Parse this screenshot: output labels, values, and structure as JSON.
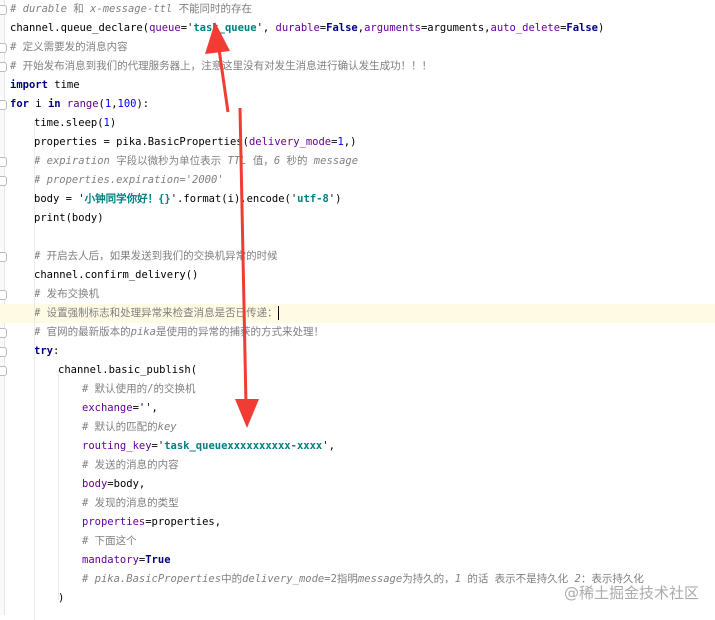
{
  "editor": {
    "lines": [
      {
        "i": 0,
        "fold": true,
        "tokens": [
          [
            "# durable ",
            "cm"
          ],
          [
            "和 ",
            "cn"
          ],
          [
            "x-message-ttl ",
            "cm"
          ],
          [
            "不能同时的存在",
            "cn"
          ]
        ]
      },
      {
        "i": 0,
        "tokens": [
          [
            "channel.queue_declare(",
            ""
          ],
          [
            "queue",
            "arg"
          ],
          [
            "='",
            ""
          ],
          [
            "task_queue",
            "str"
          ],
          [
            "', ",
            ""
          ],
          [
            "durable",
            "arg"
          ],
          [
            "=",
            ""
          ],
          [
            "False",
            "kw"
          ],
          [
            ",",
            ""
          ],
          [
            "arguments",
            "arg"
          ],
          [
            "=arguments,",
            ""
          ],
          [
            "auto_delete",
            "arg"
          ],
          [
            "=",
            ""
          ],
          [
            "False",
            "kw"
          ],
          [
            ")",
            ""
          ]
        ]
      },
      {
        "i": 0,
        "fold": true,
        "tokens": [
          [
            "# 定义需要发的消息内容",
            "cn"
          ]
        ]
      },
      {
        "i": 0,
        "fold": true,
        "tokens": [
          [
            "# 开始发布消息到我们的代理服务器上，注意这里没有对发生消息进行确认发生成功！！！",
            "cn"
          ]
        ]
      },
      {
        "i": 0,
        "tokens": [
          [
            "import",
            "kw"
          ],
          [
            " time",
            ""
          ]
        ]
      },
      {
        "i": 0,
        "fold": true,
        "tokens": [
          [
            "for",
            "kw"
          ],
          [
            " i ",
            ""
          ],
          [
            "in",
            "kw"
          ],
          [
            " ",
            ""
          ],
          [
            "range",
            "arg"
          ],
          [
            "(",
            ""
          ],
          [
            "1",
            "num"
          ],
          [
            ",",
            ""
          ],
          [
            "100",
            "num"
          ],
          [
            "):",
            ""
          ]
        ]
      },
      {
        "i": 1,
        "tokens": [
          [
            "time.sleep(",
            ""
          ],
          [
            "1",
            "num"
          ],
          [
            ")",
            ""
          ]
        ]
      },
      {
        "i": 1,
        "tokens": [
          [
            "properties = pika.BasicProperties(",
            ""
          ],
          [
            "delivery_mode",
            "arg"
          ],
          [
            "=",
            ""
          ],
          [
            "1",
            "num"
          ],
          [
            ",)",
            ""
          ]
        ]
      },
      {
        "i": 1,
        "fold": true,
        "tokens": [
          [
            "# expiration ",
            "cm"
          ],
          [
            "字段以微秒为单位表示 ",
            "cn"
          ],
          [
            "TTL ",
            "cm"
          ],
          [
            "值，",
            "cn"
          ],
          [
            "6 ",
            "cm"
          ],
          [
            "秒的 ",
            "cn"
          ],
          [
            "message",
            "cm"
          ]
        ]
      },
      {
        "i": 1,
        "fold": true,
        "tokens": [
          [
            "# properties.expiration='2000'",
            "cm"
          ]
        ]
      },
      {
        "i": 1,
        "tokens": [
          [
            "body = '",
            ""
          ],
          [
            "小钟同学你好！{}",
            "str"
          ],
          [
            "'.format(i).encode('",
            ""
          ],
          [
            "utf-8",
            "str"
          ],
          [
            "')",
            ""
          ]
        ]
      },
      {
        "i": 1,
        "tokens": [
          [
            "print(body)",
            ""
          ]
        ]
      },
      {
        "i": 1,
        "tokens": []
      },
      {
        "i": 1,
        "fold": true,
        "tokens": [
          [
            "# 开启去人后，如果发送到我们的交换机异常的时候",
            "cn"
          ]
        ]
      },
      {
        "i": 1,
        "tokens": [
          [
            "channel.confirm_delivery()",
            ""
          ]
        ]
      },
      {
        "i": 1,
        "fold": true,
        "tokens": [
          [
            "# 发布交换机",
            "cn"
          ]
        ]
      },
      {
        "i": 1,
        "hl": true,
        "caret": true,
        "tokens": [
          [
            "# 设置强制标志和处理异常来检查消息是否已传递：",
            "cn"
          ]
        ]
      },
      {
        "i": 1,
        "fold": true,
        "tokens": [
          [
            "# 官网的最新版本的",
            "cn"
          ],
          [
            "pika",
            "cm"
          ],
          [
            "是使用的异常的捕获的方式来处理！",
            "cn"
          ]
        ]
      },
      {
        "i": 1,
        "fold": true,
        "tokens": [
          [
            "try",
            "kw"
          ],
          [
            ":",
            ""
          ]
        ]
      },
      {
        "i": 2,
        "fold": true,
        "tokens": [
          [
            "channel.basic_publish(",
            ""
          ]
        ]
      },
      {
        "i": 3,
        "tokens": [
          [
            "# 默认使用的/的交换机",
            "cn"
          ]
        ]
      },
      {
        "i": 3,
        "tokens": [
          [
            "exchange",
            "arg"
          ],
          [
            "='',",
            ""
          ]
        ]
      },
      {
        "i": 3,
        "tokens": [
          [
            "# 默认的匹配的",
            "cn"
          ],
          [
            "key",
            "cm"
          ]
        ]
      },
      {
        "i": 3,
        "tokens": [
          [
            "routing_key",
            "arg"
          ],
          [
            "='",
            ""
          ],
          [
            "task_queuexxxxxxxxxx-xxxx",
            "str"
          ],
          [
            "',",
            ""
          ]
        ]
      },
      {
        "i": 3,
        "tokens": [
          [
            "# 发送的消息的内容",
            "cn"
          ]
        ]
      },
      {
        "i": 3,
        "tokens": [
          [
            "body",
            "arg"
          ],
          [
            "=body,",
            ""
          ]
        ]
      },
      {
        "i": 3,
        "tokens": [
          [
            "# 发现的消息的类型",
            "cn"
          ]
        ]
      },
      {
        "i": 3,
        "tokens": [
          [
            "properties",
            "arg"
          ],
          [
            "=properties,",
            ""
          ]
        ]
      },
      {
        "i": 3,
        "tokens": [
          [
            "# 下面这个",
            "cn"
          ]
        ]
      },
      {
        "i": 3,
        "tokens": [
          [
            "mandatory",
            "arg"
          ],
          [
            "=",
            ""
          ],
          [
            "True",
            "kw"
          ]
        ]
      },
      {
        "i": 3,
        "tokens": [
          [
            "# pika.BasicProperties",
            "cm"
          ],
          [
            "中的",
            "cn"
          ],
          [
            "delivery_mode",
            "cm"
          ],
          [
            "=2指明",
            "cn"
          ],
          [
            "message",
            "cm"
          ],
          [
            "为持久的，",
            "cn"
          ],
          [
            "1 ",
            "cm"
          ],
          [
            "的话 表示不是持久化 ",
            "cn"
          ],
          [
            "2",
            "cm"
          ],
          [
            "：表示持久化",
            "cn"
          ]
        ]
      },
      {
        "i": 2,
        "tokens": [
          [
            ")",
            ""
          ]
        ]
      }
    ]
  },
  "watermark": "@稀土掘金技术社区",
  "colors": {
    "arrow": "#f03c32",
    "keyword": "#000080",
    "string": "#008080",
    "comment": "#808080"
  }
}
